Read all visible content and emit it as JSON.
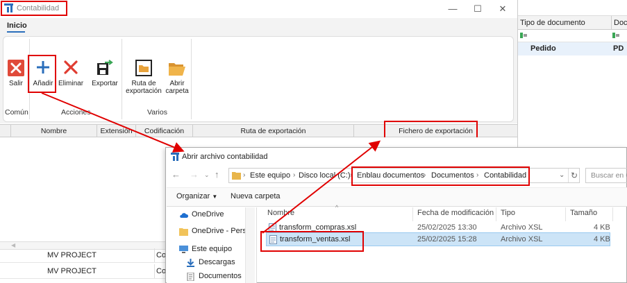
{
  "main_window": {
    "title": "Contabilidad",
    "controls": {
      "minimize": "—",
      "maximize": "☐",
      "close": "✕"
    },
    "tab": "Inicio",
    "buttons": {
      "salir": "Salir",
      "anadir": "Añadir",
      "eliminar": "Eliminar",
      "exportar": "Exportar",
      "ruta_line1": "Ruta de",
      "ruta_line2": "exportación",
      "abrir_line1": "Abrir",
      "abrir_line2": "carpeta"
    },
    "groups": {
      "comun": "Común",
      "acciones": "Acciones",
      "varios": "Varios"
    },
    "grid_columns": [
      "Nombre",
      "Extensión",
      "Codificación",
      "Ruta de exportación",
      "Fichero de exportación"
    ],
    "lower_rows": [
      {
        "name": "MV PROJECT",
        "extra": "Co"
      },
      {
        "name": "MV PROJECT",
        "extra": "Co"
      }
    ]
  },
  "right_panel": {
    "columns": [
      "Tipo de documento",
      "Doc"
    ],
    "row": {
      "tipo": "Pedido",
      "doc": "PD"
    }
  },
  "dialog": {
    "title": "Abrir archivo contabilidad",
    "path": [
      "Este equipo",
      "Disco local (C:)",
      "Enblau documentos",
      "Documentos",
      "Contabilidad"
    ],
    "search_placeholder": "Buscar en C",
    "toolbar": {
      "organize": "Organizar",
      "new_folder": "Nueva carpeta"
    },
    "nav_items": [
      "OneDrive",
      "OneDrive - Person",
      "Este equipo",
      "Descargas",
      "Documentos"
    ],
    "columns": {
      "name": "Nombre",
      "date": "Fecha de modificación",
      "type": "Tipo",
      "size": "Tamaño"
    },
    "files": [
      {
        "name": "transform_compras.xsl",
        "date": "25/02/2025 13:30",
        "type": "Archivo XSL",
        "size": "4 KB"
      },
      {
        "name": "transform_ventas.xsl",
        "date": "25/02/2025 15:28",
        "type": "Archivo XSL",
        "size": "4 KB"
      }
    ]
  },
  "colors": {
    "annotation": "#e00000",
    "selection": "#cce4f7",
    "accent": "#2a6ebb"
  }
}
